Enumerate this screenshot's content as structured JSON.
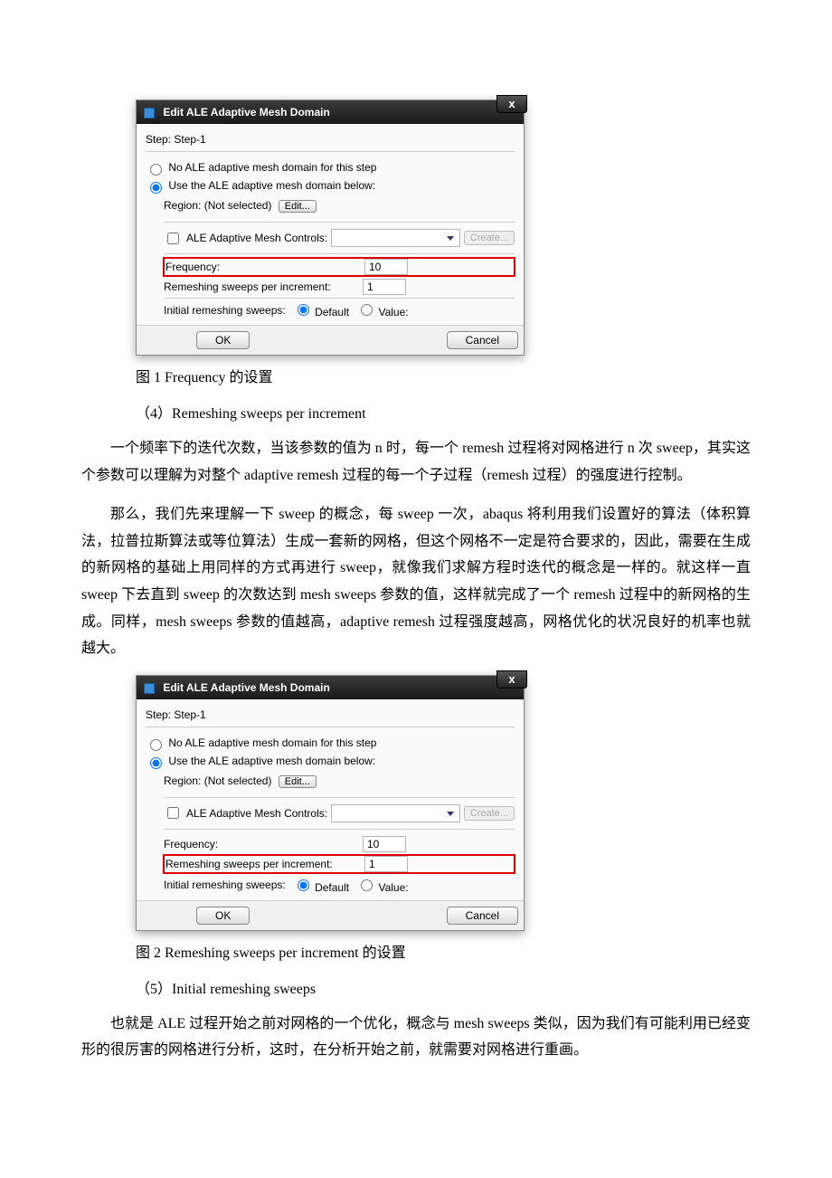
{
  "dialog": {
    "title": "Edit ALE Adaptive Mesh Domain",
    "step_label": "Step:",
    "step_value": "Step-1",
    "radio_none": "No ALE adaptive mesh domain for this step",
    "radio_use": "Use the ALE adaptive mesh domain below:",
    "region_label": "Region:",
    "region_value": "(Not selected)",
    "edit_btn": "Edit...",
    "controls_label": "ALE Adaptive Mesh Controls:",
    "create_btn": "Create...",
    "freq_label": "Frequency:",
    "freq_value": "10",
    "sweeps_label": "Remeshing sweeps per increment:",
    "sweeps_value": "1",
    "initial_label": "Initial remeshing sweeps:",
    "default_label": "Default",
    "value_label": "Value:",
    "ok": "OK",
    "cancel": "Cancel",
    "close": "x"
  },
  "text": {
    "caption1": "图 1 Frequency 的设置",
    "heading4": "（4）Remeshing sweeps per increment",
    "p1": "一个频率下的迭代次数，当该参数的值为 n 时，每一个 remesh 过程将对网格进行 n 次 sweep，其实这个参数可以理解为对整个 adaptive remesh 过程的每一个子过程（remesh 过程）的强度进行控制。",
    "p2": "那么，我们先来理解一下 sweep 的概念，每 sweep 一次，abaqus 将利用我们设置好的算法（体积算法，拉普拉斯算法或等位算法）生成一套新的网格，但这个网格不一定是符合要求的，因此，需要在生成的新网格的基础上用同样的方式再进行 sweep，就像我们求解方程时迭代的概念是一样的。就这样一直 sweep 下去直到 sweep 的次数达到 mesh sweeps 参数的值，这样就完成了一个 remesh 过程中的新网格的生成。同样，mesh sweeps 参数的值越高，adaptive remesh 过程强度越高，网格优化的状况良好的机率也就越大。",
    "caption2": "图 2 Remeshing sweeps per increment 的设置",
    "heading5": "（5）Initial remeshing sweeps",
    "p3": "也就是 ALE 过程开始之前对网格的一个优化，概念与 mesh sweeps 类似，因为我们有可能利用已经变形的很厉害的网格进行分析，这时，在分析开始之前，就需要对网格进行重画。"
  }
}
